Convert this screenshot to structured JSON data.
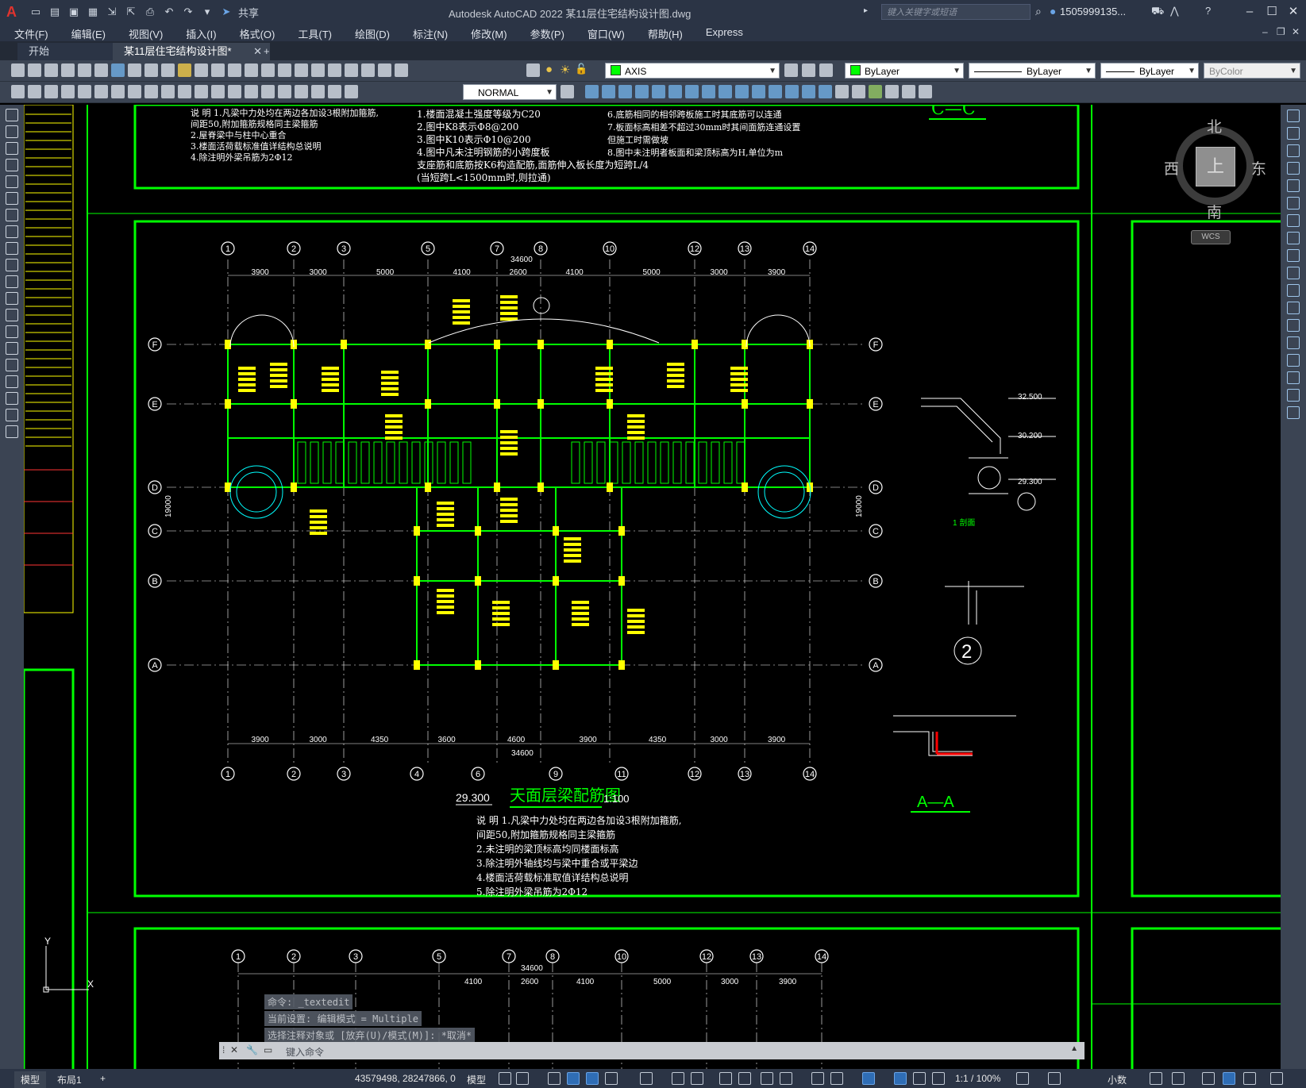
{
  "app": {
    "title": "Autodesk AutoCAD 2022    某11层住宅结构设计图.dwg",
    "search_placeholder": "键入关键字或短语",
    "user": "1505999135...",
    "share_label": "共享",
    "logo_letter": "A"
  },
  "menu": [
    "文件(F)",
    "编辑(E)",
    "视图(V)",
    "插入(I)",
    "格式(O)",
    "工具(T)",
    "绘图(D)",
    "标注(N)",
    "修改(M)",
    "参数(P)",
    "窗口(W)",
    "帮助(H)",
    "Express"
  ],
  "file_tabs": {
    "start": "开始",
    "active": "某11层住宅结构设计图*"
  },
  "properties": {
    "layer": "AXIS",
    "color": "ByLayer",
    "linetype": "ByLayer",
    "lineweight": "ByLayer",
    "plotstyle": "ByColor",
    "textstyle": "NORMAL"
  },
  "viewcube": {
    "north": "北",
    "south": "南",
    "east": "东",
    "west": "西",
    "top": "上",
    "wcs": "WCS"
  },
  "drawing": {
    "title": "天面层梁配筋图",
    "scale": "1:100",
    "elevation": "29.300",
    "total_dim": "34600",
    "total_height": "19000",
    "top_dims": [
      "3900",
      "3000",
      "5000",
      "4100",
      "2600",
      "4100",
      "5000",
      "3000",
      "3900"
    ],
    "bottom_dims": [
      "3900",
      "3000",
      "4350",
      "3600",
      "4600",
      "3900",
      "4350",
      "3000",
      "3900"
    ],
    "col_axes_top": [
      "1",
      "2",
      "3",
      "5",
      "7",
      "8",
      "10",
      "12",
      "13",
      "14"
    ],
    "col_axes_bottom": [
      "1",
      "2",
      "3",
      "4",
      "6",
      "9",
      "11",
      "12",
      "13",
      "14"
    ],
    "row_axes": [
      "F",
      "E",
      "D",
      "C",
      "B",
      "A"
    ],
    "section_top": "C—C",
    "section_aa": "A—A",
    "section_1": "1 剖面",
    "detail_2": "2",
    "elev_labels": [
      "32.500",
      "30.200",
      "29.300"
    ],
    "notes_main": [
      "说 明 1.凡梁中力处均在两边各加设3根附加箍筋,",
      "    间距50,附加箍筋规格同主梁箍筋",
      "  2.未注明的梁顶标高均同楼面标高",
      "  3.除注明外轴线均与梁中重合或平梁边",
      "  4.楼面活荷载标准取值详结构总说明",
      "  5.除注明外梁吊筋为2Φ12"
    ],
    "notes_top_left": [
      "说 明 1.凡梁中力处均在两边各加设3根附加箍筋,",
      "    间距50,附加箍筋规格同主梁箍筋",
      "  2.屋脊梁中与柱中心重合",
      "  3.楼面活荷载标准值详结构总说明",
      "  4.除注明外梁吊筋为2Φ12"
    ],
    "notes_top_mid": [
      "1.楼面混凝土强度等级为C20",
      "2.图中K8表示Φ8@200",
      "3.图中K10表示Φ10@200",
      "4.图中凡未注明钢筋的小跨度板",
      "  支座筋和底筋按K6构造配筋,面筋伸入板长度为短跨L/4",
      "  (当短跨L<1500mm时,则拉通)"
    ],
    "notes_top_right": [
      "6.底筋相同的相邻跨板施工时其底筋可以连通",
      "7.板面标高相差不超过30mm时其间面筋连通设置",
      "  但施工时需做坡",
      "8.图中未注明者板面和梁顶标高为H,单位为m"
    ],
    "lower_axes": [
      "1",
      "2",
      "3",
      "5",
      "7",
      "8",
      "10",
      "12",
      "13",
      "14"
    ],
    "lower_dims": [
      "4100",
      "2600",
      "4100",
      "5000",
      "3000",
      "3900"
    ]
  },
  "command": {
    "history": [
      "命令: _textedit",
      "当前设置: 编辑模式 = Multiple",
      "选择注释对象或 [放弃(U)/模式(M)]: *取消*"
    ],
    "placeholder": "键入命令"
  },
  "status": {
    "model_tab": "模型",
    "layout_tab": "布局1",
    "coords": "43579498, 28247866, 0",
    "model_label": "模型",
    "scale": "1:1 / 100%",
    "units": "小数"
  },
  "colors": {
    "green": "#00ff00",
    "yellow": "#ffff00",
    "cyan": "#00ffff",
    "white": "#ffffff",
    "red": "#ff0000"
  }
}
